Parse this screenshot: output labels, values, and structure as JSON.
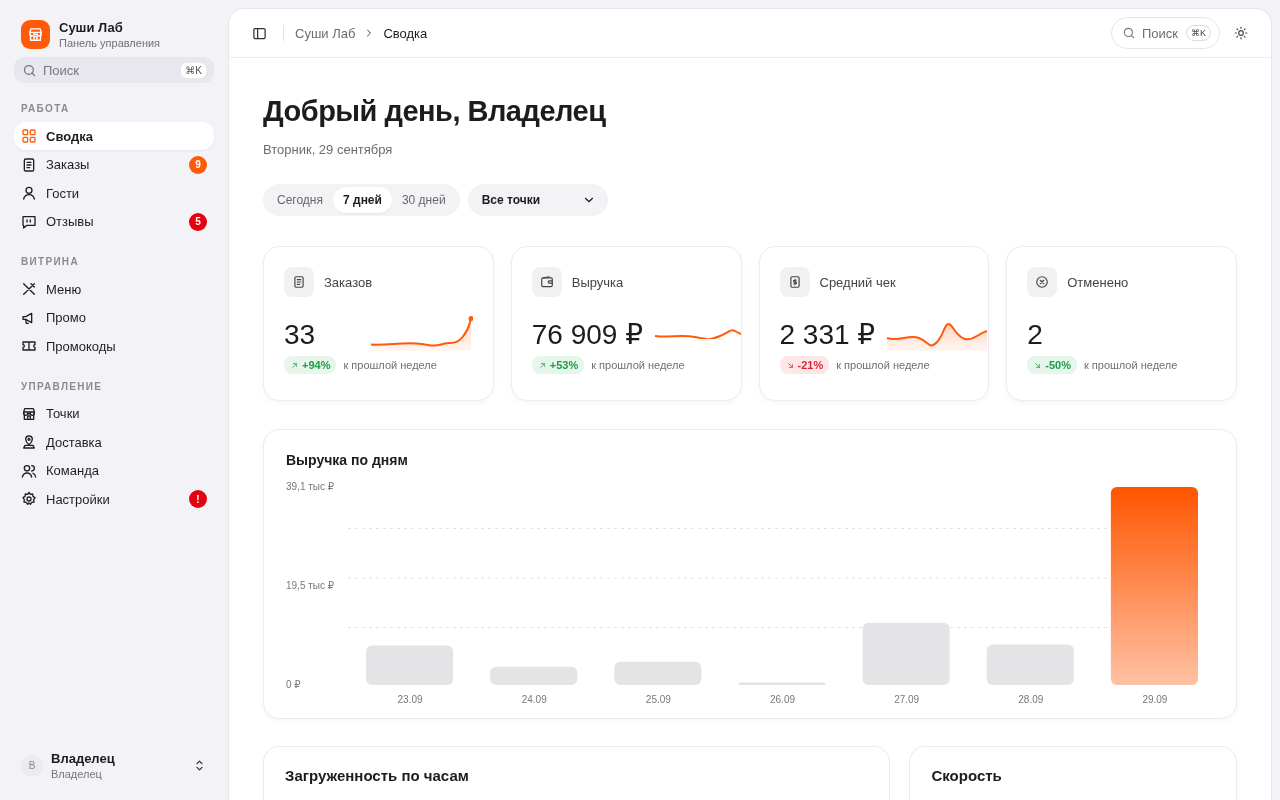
{
  "sidebar": {
    "brand": {
      "name": "Суши Лаб",
      "subtitle": "Панель управления"
    },
    "search": {
      "placeholder": "Поиск",
      "shortcut": "⌘K"
    },
    "sections": [
      {
        "title": "РАБОТА",
        "items": [
          {
            "label": "Сводка",
            "selected": true
          },
          {
            "label": "Заказы",
            "selected": false,
            "badge": "9",
            "color": "#ff5a0a"
          },
          {
            "label": "Гости",
            "selected": false
          },
          {
            "label": "Отзывы",
            "selected": false,
            "badge": "5",
            "color": "#e5000f"
          }
        ]
      },
      {
        "title": "ВИТРИНА",
        "items": [
          {
            "label": "Меню",
            "selected": false
          },
          {
            "label": "Промо",
            "selected": false
          },
          {
            "label": "Промокоды",
            "selected": false
          }
        ]
      },
      {
        "title": "УПРАВЛЕНИЕ",
        "items": [
          {
            "label": "Точки",
            "selected": false
          },
          {
            "label": "Доставка",
            "selected": false
          },
          {
            "label": "Команда",
            "selected": false
          },
          {
            "label": "Настройки",
            "selected": false,
            "badge": "!",
            "color": "#e5000f"
          }
        ]
      }
    ],
    "user": {
      "initial": "В",
      "name": "Владелец",
      "role": "Владелец"
    }
  },
  "topbar": {
    "breadcrumbs": [
      "Суши Лаб",
      "Сводка"
    ],
    "search": {
      "placeholder": "Поиск",
      "shortcut": "⌘K"
    }
  },
  "greeting": {
    "title": "Добрый день, Владелец",
    "date": "Вторник, 29 сентября"
  },
  "period_tabs": [
    {
      "label": "Сегодня",
      "selected": false
    },
    {
      "label": "7 дней",
      "selected": true
    },
    {
      "label": "30 дней",
      "selected": false
    }
  ],
  "location_select": {
    "value": "Все точки"
  },
  "stats": [
    {
      "label": "Заказов",
      "value": "33",
      "delta": "+94%",
      "rising": true,
      "favorable": true,
      "note": "к прошлой неделе"
    },
    {
      "label": "Выручка",
      "value": "76 909 ₽",
      "delta": "+53%",
      "rising": true,
      "favorable": true,
      "note": "к прошлой неделе"
    },
    {
      "label": "Средний чек",
      "value": "2 331 ₽",
      "delta": "-21%",
      "rising": false,
      "favorable": false,
      "note": "к прошлой неделе"
    },
    {
      "label": "Отменено",
      "value": "2",
      "delta": "-50%",
      "rising": false,
      "favorable": true,
      "note": "к прошлой неделе"
    }
  ],
  "revenue_chart": {
    "title": "Выручка по дням",
    "chart_data": {
      "type": "bar",
      "categories": [
        "23.09",
        "24.09",
        "25.09",
        "26.09",
        "27.09",
        "28.09",
        "29.09"
      ],
      "values": [
        7.8,
        3.6,
        4.6,
        0.5,
        12.3,
        8.0,
        39.1
      ],
      "ylim": [
        0,
        39.1
      ],
      "yticks": [
        {
          "value": 0,
          "label": "0 ₽"
        },
        {
          "value": 19.5,
          "label": "19,5 тыс ₽"
        },
        {
          "value": 39.1,
          "label": "39,1 тыс ₽"
        }
      ]
    }
  },
  "panels": [
    {
      "title": "Загруженность по часам"
    },
    {
      "title": "Скорость"
    }
  ]
}
